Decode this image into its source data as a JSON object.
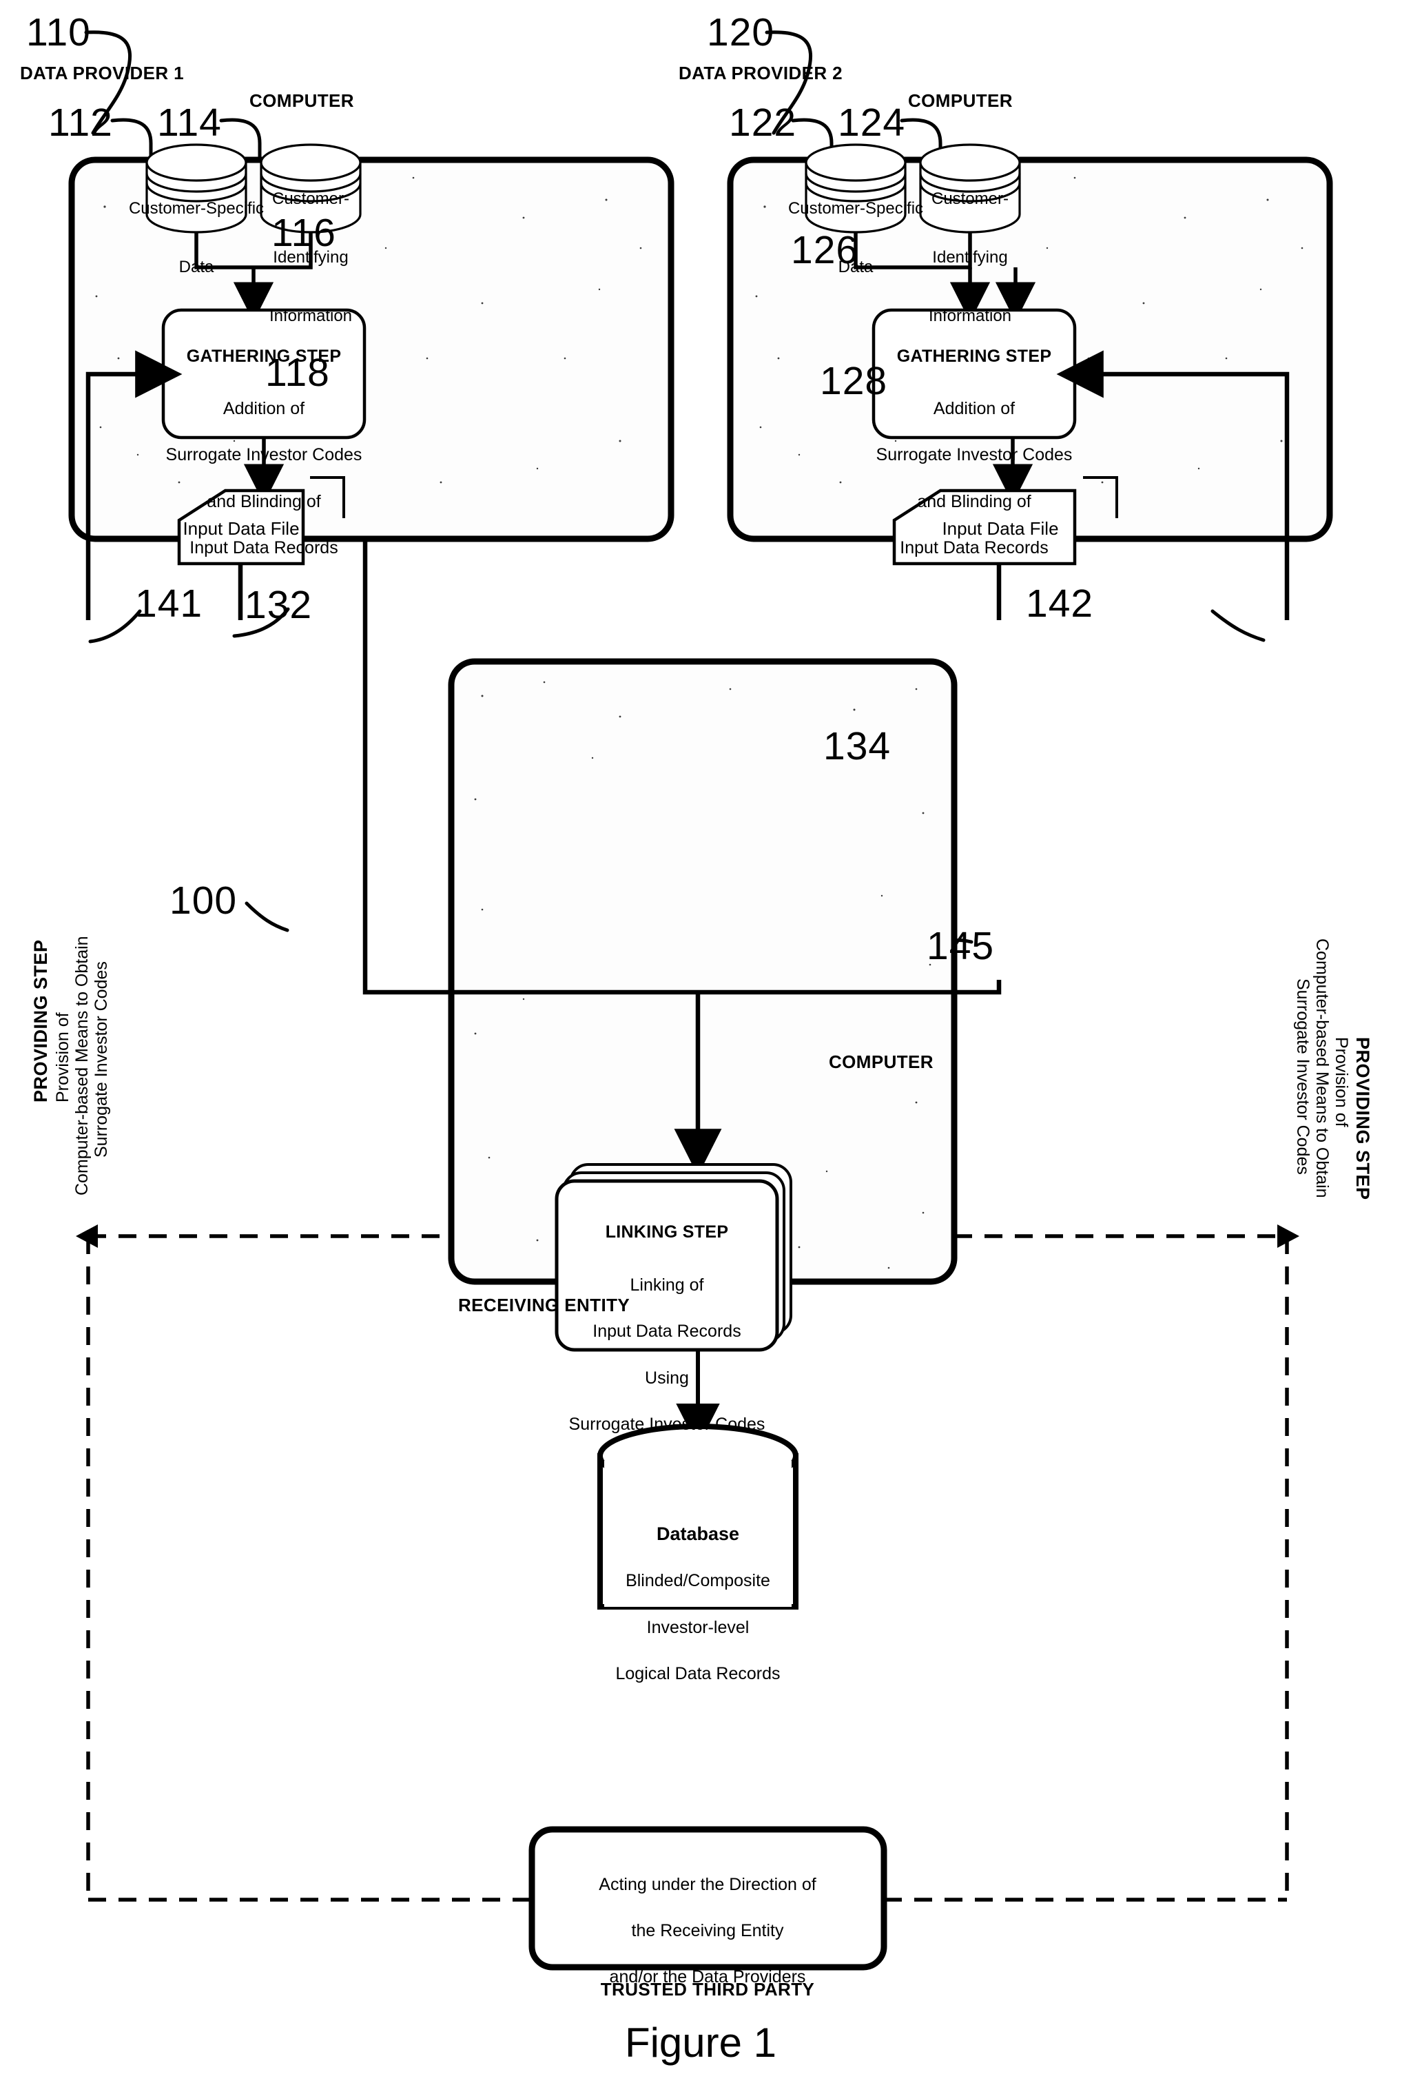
{
  "figure": {
    "caption": "Figure 1"
  },
  "providers": [
    {
      "ref": "110",
      "title": "DATA PROVIDER 1",
      "computer_label": "COMPUTER",
      "db_left": {
        "ref": "112",
        "lines": [
          "Customer-Specific",
          "Data"
        ]
      },
      "db_right": {
        "ref": "114",
        "lines": [
          "Customer-",
          "Identifying",
          "Information"
        ]
      },
      "step": {
        "ref": "116",
        "title": "GATHERING STEP",
        "lines": [
          "Addition of",
          "Surrogate Investor Codes",
          "and Blinding of",
          "Input Data Records"
        ]
      },
      "file": {
        "ref": "118",
        "label": "Input Data File"
      }
    },
    {
      "ref": "120",
      "title": "DATA PROVIDER 2",
      "computer_label": "COMPUTER",
      "db_left": {
        "ref": "122",
        "lines": [
          "Customer-Specific",
          "Data"
        ]
      },
      "db_right": {
        "ref": "124",
        "lines": [
          "Customer-",
          "Identifying",
          "Information"
        ]
      },
      "step": {
        "ref": "126",
        "title": "GATHERING STEP",
        "lines": [
          "Addition of",
          "Surrogate Investor Codes",
          "and Blinding of",
          "Input Data Records"
        ]
      },
      "file": {
        "ref": "128",
        "label": "Input Data File"
      }
    }
  ],
  "receiving_entity": {
    "ref": "100",
    "title": "RECEIVING ENTITY",
    "computer_label": "COMPUTER",
    "linking_step": {
      "ref": "132",
      "title": "LINKING STEP",
      "lines": [
        "Linking of",
        "Input Data Records",
        "Using",
        "Surrogate Investor Codes"
      ]
    },
    "database": {
      "ref": "134",
      "title": "Database",
      "lines": [
        "Blinded/Composite",
        "Investor-level",
        "Logical Data Records"
      ]
    }
  },
  "providing_steps": [
    {
      "ref": "141",
      "title": "PROVIDING STEP",
      "lines": [
        "Provision of",
        "Computer-based Means to Obtain",
        "Surrogate Investor Codes"
      ]
    },
    {
      "ref": "142",
      "title": "PROVIDING STEP",
      "lines": [
        "Provision of",
        "Computer-based Means to Obtain",
        "Surrogate Investor Codes"
      ]
    }
  ],
  "trusted_third_party": {
    "ref": "145",
    "title": "TRUSTED THIRD PARTY",
    "lines": [
      "Acting under the Direction of",
      "the Receiving Entity",
      "and/or the Data Providers"
    ]
  }
}
